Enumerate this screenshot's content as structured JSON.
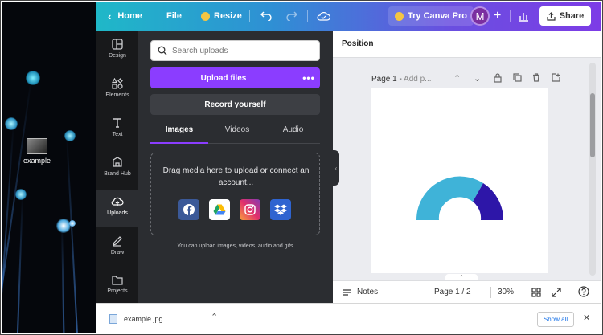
{
  "desktop": {
    "icon_label": "example"
  },
  "topbar": {
    "home": "Home",
    "file": "File",
    "resize": "Resize",
    "try_pro": "Try Canva Pro",
    "avatar_letter": "M",
    "share": "Share",
    "gradient_colors": [
      "#1fb8c8",
      "#7d3ce6"
    ]
  },
  "rail": {
    "items": [
      {
        "label": "Design",
        "icon": "layout-icon"
      },
      {
        "label": "Elements",
        "icon": "shapes-icon"
      },
      {
        "label": "Text",
        "icon": "text-icon"
      },
      {
        "label": "Brand Hub",
        "icon": "brand-icon"
      },
      {
        "label": "Uploads",
        "icon": "cloud-upload-icon"
      },
      {
        "label": "Draw",
        "icon": "pen-icon"
      },
      {
        "label": "Projects",
        "icon": "folder-icon"
      }
    ]
  },
  "panel": {
    "search_placeholder": "Search uploads",
    "upload_files": "Upload files",
    "more": "•••",
    "record": "Record yourself",
    "tabs": [
      "Images",
      "Videos",
      "Audio"
    ],
    "dropzone_text": "Drag media here to upload or connect an account...",
    "hint": "You can upload images, videos, audio and gifs",
    "accent": "#8b3dff"
  },
  "editor": {
    "position_label": "Position",
    "page_prefix": "Page 1 - ",
    "page_title_placeholder": "Add p...",
    "notes": "Notes",
    "page_indicator": "Page 1 / 2",
    "zoom": "30%"
  },
  "downloads": {
    "file_name": "example.jpg",
    "show_all": "Show all"
  }
}
